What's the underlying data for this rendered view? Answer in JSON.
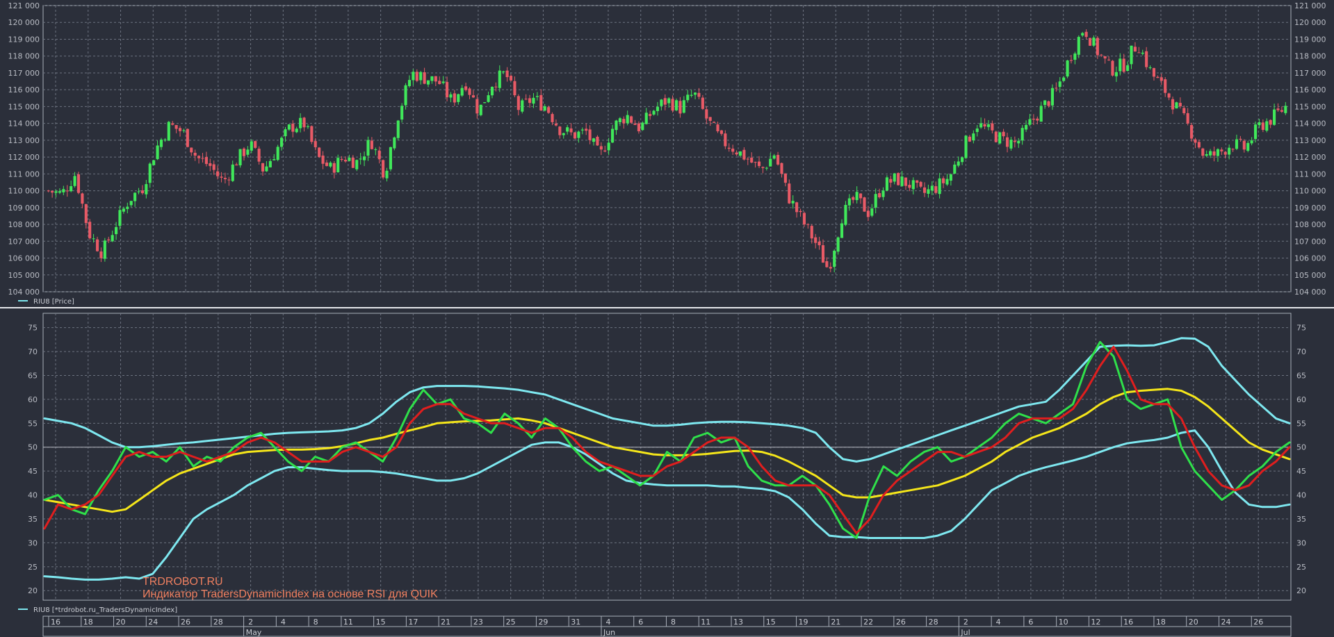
{
  "colors": {
    "background": "#2b2f3a",
    "panel_border": "#aab0bb",
    "grid": "#6d7380",
    "bull": "#40e85a",
    "bear": "#e85a66",
    "rsi_line": "#2fe04a",
    "signal_line": "#e01e1e",
    "market_base": "#f5e61a",
    "volatility_band": "#7ee8f0"
  },
  "price_legend": "RIU8 [Price]",
  "indicator_legend": "RIU8 [*trdrobot.ru_TradersDynamicIndex]",
  "watermark": {
    "line1": "TRDROBOT.RU",
    "line2": "Индикатор TradersDynamicIndex на основе RSI для QUIK"
  },
  "x_axis": {
    "day_labels": [
      "16",
      "18",
      "20",
      "24",
      "26",
      "28",
      "2",
      "4",
      "8",
      "11",
      "15",
      "17",
      "21",
      "23",
      "25",
      "29",
      "31",
      "4",
      "6",
      "8",
      "11",
      "13",
      "15",
      "19",
      "21",
      "22",
      "26",
      "28",
      "2",
      "4",
      "6",
      "10",
      "12",
      "16",
      "18",
      "20",
      "24",
      "26"
    ],
    "month_labels": [
      "May",
      "Jun",
      "Jul"
    ]
  },
  "chart_data": [
    {
      "type": "candlestick",
      "title": "RIU8 [Price]",
      "ylim": [
        104000,
        121000
      ],
      "y_ticks": [
        "104 000",
        "105 000",
        "106 000",
        "107 000",
        "108 000",
        "109 000",
        "110 000",
        "111 000",
        "112 000",
        "113 000",
        "114 000",
        "115 000",
        "116 000",
        "117 000",
        "118 000",
        "119 000",
        "120 000",
        "121 000"
      ],
      "anchor_closes": [
        110000,
        109800,
        111000,
        107500,
        106300,
        108000,
        109500,
        110200,
        112500,
        113900,
        113500,
        112000,
        111500,
        110500,
        111800,
        112800,
        111200,
        112500,
        113800,
        114000,
        112000,
        111300,
        112000,
        111700,
        113000,
        111000,
        114500,
        117000,
        116700,
        116500,
        115300,
        116500,
        114700,
        116400,
        117000,
        114800,
        115500,
        115000,
        113700,
        113300,
        113500,
        112000,
        113800,
        114500,
        113700,
        114800,
        115400,
        114900,
        115800,
        114200,
        113000,
        112500,
        111900,
        111200,
        112200,
        109700,
        108300,
        107000,
        105300,
        108500,
        109600,
        108700,
        110300,
        110700,
        110400,
        109800,
        110200,
        110800,
        112500,
        114000,
        113500,
        113000,
        112800,
        114000,
        115000,
        116000,
        118000,
        119700,
        118300,
        117200,
        117500,
        118800,
        117000,
        116000,
        114800,
        113500,
        112000,
        112200,
        112800,
        112500,
        113800,
        114300,
        115000
      ],
      "series": [
        {
          "name": "RIU8 [Price]"
        }
      ]
    },
    {
      "type": "line",
      "title": "RIU8 [*trdrobot.ru_TradersDynamicIndex]",
      "ylim": [
        18,
        78
      ],
      "y_ticks": [
        20,
        25,
        30,
        35,
        40,
        45,
        50,
        55,
        60,
        65,
        70,
        75
      ],
      "series": [
        {
          "name": "RSI price line",
          "color": "#2fe04a",
          "values": [
            39,
            40,
            37,
            36,
            41,
            45,
            50,
            48,
            49,
            47,
            50,
            46,
            48,
            47,
            50,
            52,
            53,
            50,
            47,
            45,
            48,
            47,
            50,
            51,
            49,
            47,
            52,
            58,
            62,
            59,
            60,
            56,
            55,
            53,
            57,
            55,
            52,
            56,
            54,
            50,
            47,
            45,
            46,
            44,
            42,
            44,
            49,
            47,
            52,
            53,
            51,
            52,
            46,
            43,
            42,
            42,
            44,
            42,
            38,
            33,
            31,
            40,
            46,
            44,
            47,
            49,
            50,
            47,
            48,
            50,
            52,
            55,
            57,
            56,
            55,
            57,
            59,
            67,
            72,
            69,
            60,
            58,
            59,
            60,
            50,
            45,
            42,
            39,
            41,
            44,
            46,
            49,
            51
          ]
        },
        {
          "name": "Trade signal line",
          "color": "#e01e1e",
          "values": [
            33,
            38,
            37,
            38,
            40,
            44,
            48,
            49,
            48,
            48,
            49,
            48,
            47,
            48,
            49,
            51,
            52,
            51,
            49,
            47,
            47,
            47,
            49,
            50,
            49,
            48,
            50,
            55,
            58,
            59,
            59,
            57,
            56,
            55,
            55,
            54,
            53,
            54,
            54,
            52,
            49,
            47,
            46,
            45,
            44,
            44,
            46,
            47,
            49,
            51,
            52,
            52,
            50,
            46,
            43,
            42,
            42,
            42,
            40,
            36,
            32,
            35,
            40,
            43,
            45,
            47,
            49,
            49,
            48,
            49,
            50,
            52,
            55,
            56,
            56,
            56,
            58,
            62,
            67,
            71,
            66,
            60,
            59,
            59,
            56,
            50,
            45,
            42,
            41,
            42,
            45,
            47,
            50
          ]
        },
        {
          "name": "Market base line",
          "color": "#f5e61a",
          "values": [
            39,
            38.5,
            38,
            37.5,
            37,
            36.5,
            37,
            39,
            41,
            43,
            44.5,
            45.5,
            46.5,
            47.5,
            48.5,
            49,
            49.2,
            49.4,
            49.5,
            49.5,
            49.6,
            49.8,
            50.2,
            50.8,
            51.5,
            52,
            52.8,
            53.5,
            54.2,
            55,
            55.2,
            55.4,
            55.5,
            55.6,
            55.8,
            56,
            55.6,
            55,
            54,
            53,
            52,
            51,
            50,
            49.5,
            49,
            48.5,
            48.3,
            48.3,
            48.4,
            48.6,
            48.9,
            49.2,
            49.3,
            49,
            48.2,
            47,
            45.5,
            44,
            42,
            40,
            39.5,
            39.5,
            40,
            40.5,
            41,
            41.5,
            42,
            43,
            44,
            45.5,
            47,
            49,
            50.5,
            52,
            53,
            54,
            55.5,
            57,
            59,
            60.5,
            61.5,
            61.8,
            62,
            62.2,
            61.8,
            60.5,
            58.5,
            56,
            53.5,
            51,
            49.5,
            48.5,
            47.5
          ]
        },
        {
          "name": "Volatility band upper",
          "color": "#7ee8f0",
          "values": [
            56,
            55.5,
            55,
            54,
            52.5,
            51,
            50,
            50,
            50.2,
            50.5,
            50.8,
            51,
            51.3,
            51.6,
            51.9,
            52.2,
            52.5,
            52.8,
            53,
            53.1,
            53.2,
            53.3,
            53.5,
            54,
            55,
            57,
            59.5,
            61.5,
            62.5,
            62.8,
            62.8,
            62.8,
            62.7,
            62.5,
            62.3,
            62,
            61.5,
            61,
            60,
            59,
            58,
            57,
            56,
            55.5,
            55,
            54.5,
            54.5,
            54.7,
            55,
            55.2,
            55.3,
            55.3,
            55.2,
            55,
            54.8,
            54.5,
            54,
            53,
            50,
            47.5,
            47,
            47.5,
            48.5,
            49.5,
            50.5,
            51.5,
            52.5,
            53.5,
            54.5,
            55.5,
            56.5,
            57.5,
            58.5,
            59,
            59.5,
            62,
            65,
            68,
            71,
            71.2,
            71.3,
            71.2,
            71.3,
            72,
            72.8,
            72.7,
            71,
            67,
            64,
            61,
            58.5,
            56,
            55
          ]
        },
        {
          "name": "Volatility band lower",
          "color": "#7ee8f0",
          "values": [
            23,
            22.8,
            22.5,
            22.3,
            22.3,
            22.5,
            22.8,
            22.5,
            23.5,
            27,
            31,
            35,
            37,
            38.5,
            40,
            42,
            43.5,
            45,
            45.8,
            45.8,
            45.5,
            45.2,
            45,
            45,
            45,
            44.8,
            44.5,
            44,
            43.5,
            43,
            43,
            43.5,
            44.5,
            46,
            47.5,
            49,
            50.5,
            51,
            51,
            50,
            48.5,
            46.5,
            44.5,
            43,
            42.5,
            42.2,
            42,
            42,
            42,
            42,
            41.8,
            41.8,
            41.5,
            41.3,
            40.8,
            39.5,
            37,
            34,
            31.5,
            31.2,
            31.2,
            31,
            31,
            31,
            31,
            31,
            31.5,
            32.5,
            35,
            38,
            41,
            42.5,
            44,
            45,
            45.8,
            46.5,
            47.2,
            48,
            49,
            50,
            50.8,
            51.2,
            51.5,
            52,
            53,
            53.5,
            50,
            45,
            40.5,
            38,
            37.5,
            37.5,
            38
          ]
        }
      ]
    }
  ]
}
